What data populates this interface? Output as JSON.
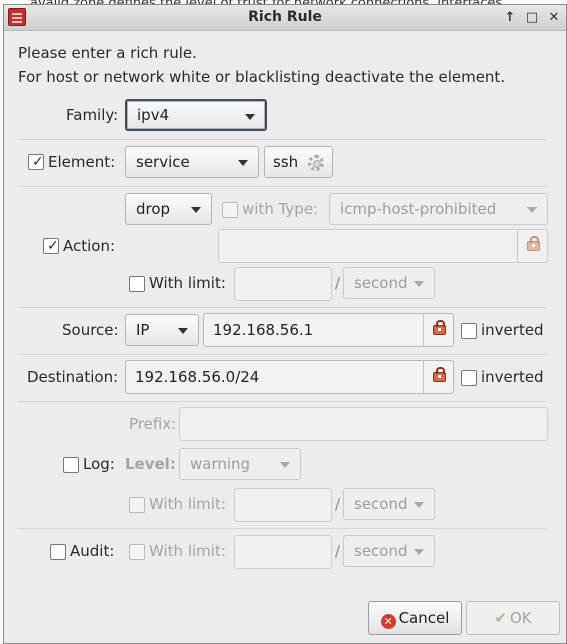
{
  "background": {
    "text": "avalid zone defines the level of trust for network connections, interfaces"
  },
  "window": {
    "title": "Rich Rule",
    "intro_line1": "Please enter a rich rule.",
    "intro_line2": "For host or network white or blacklisting deactivate the element."
  },
  "family": {
    "label": "Family:",
    "value": "ipv4"
  },
  "element": {
    "label": "Element:",
    "checked": true,
    "type": "service",
    "value": "ssh"
  },
  "action": {
    "label": "Action:",
    "checked": true,
    "type": "drop",
    "with_type_label": "with Type:",
    "with_type_checked": false,
    "type_value": "icmp-host-prohibited",
    "entry_value": "",
    "with_limit_label": "With limit:",
    "with_limit_checked": false,
    "limit_value": "",
    "limit_unit": "second"
  },
  "source": {
    "label": "Source:",
    "type": "IP",
    "value": "192.168.56.1",
    "inverted_label": "inverted",
    "inverted": false
  },
  "destination": {
    "label": "Destination:",
    "value": "192.168.56.0/24",
    "inverted_label": "inverted",
    "inverted": false
  },
  "log": {
    "label": "Log:",
    "checked": false,
    "prefix_label": "Prefix:",
    "prefix_value": "",
    "level_label": "Level:",
    "level_value": "warning",
    "with_limit_label": "With limit:",
    "limit_value": "",
    "limit_unit": "second"
  },
  "audit": {
    "label": "Audit:",
    "checked": false,
    "with_limit_label": "With limit:",
    "limit_value": "",
    "limit_unit": "second"
  },
  "separator": "/",
  "buttons": {
    "cancel": "Cancel",
    "ok": "OK"
  }
}
